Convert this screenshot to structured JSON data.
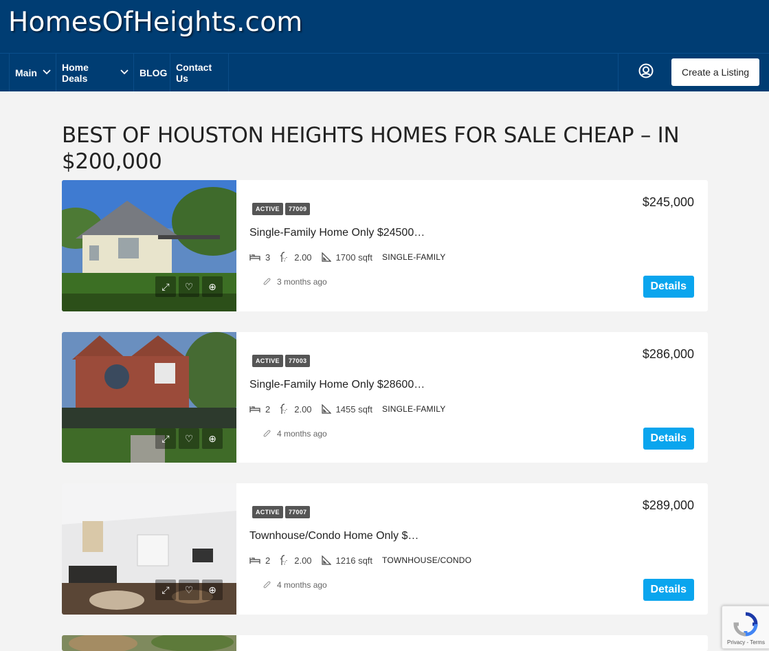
{
  "site": {
    "logo": "HomesOfHeights.com"
  },
  "nav": {
    "items": [
      {
        "label": "Main",
        "dropdown": true
      },
      {
        "label": "Home Deals",
        "dropdown": true
      },
      {
        "label": "BLOG",
        "dropdown": false
      },
      {
        "label": "Contact Us",
        "dropdown": false
      }
    ],
    "user_icon": "user-circle-icon",
    "create_listing": "Create a Listing"
  },
  "page": {
    "title": "BEST OF HOUSTON HEIGHTS HOMES FOR SALE CHEAP – IN $200,000"
  },
  "listings": [
    {
      "status": "ACTIVE",
      "zip": "77009",
      "title": "Single-Family Home Only $24500…",
      "price": "$245,000",
      "beds": "3",
      "baths": "2.00",
      "sqft": "1700 sqft",
      "type": "SINGLE-FAMILY",
      "time": "3 months ago",
      "details": "Details"
    },
    {
      "status": "ACTIVE",
      "zip": "77003",
      "title": "Single-Family Home Only $28600…",
      "price": "$286,000",
      "beds": "2",
      "baths": "2.00",
      "sqft": "1455 sqft",
      "type": "SINGLE-FAMILY",
      "time": "4 months ago",
      "details": "Details"
    },
    {
      "status": "ACTIVE",
      "zip": "77007",
      "title": "Townhouse/Condo Home Only $…",
      "price": "$289,000",
      "beds": "2",
      "baths": "2.00",
      "sqft": "1216 sqft",
      "type": "TOWNHOUSE/CONDO",
      "time": "4 months ago",
      "details": "Details"
    }
  ],
  "recaptcha": {
    "text": "Privacy - Terms"
  },
  "colors": {
    "header": "#003d73",
    "accent": "#0aa5ee",
    "badge": "#555555"
  }
}
